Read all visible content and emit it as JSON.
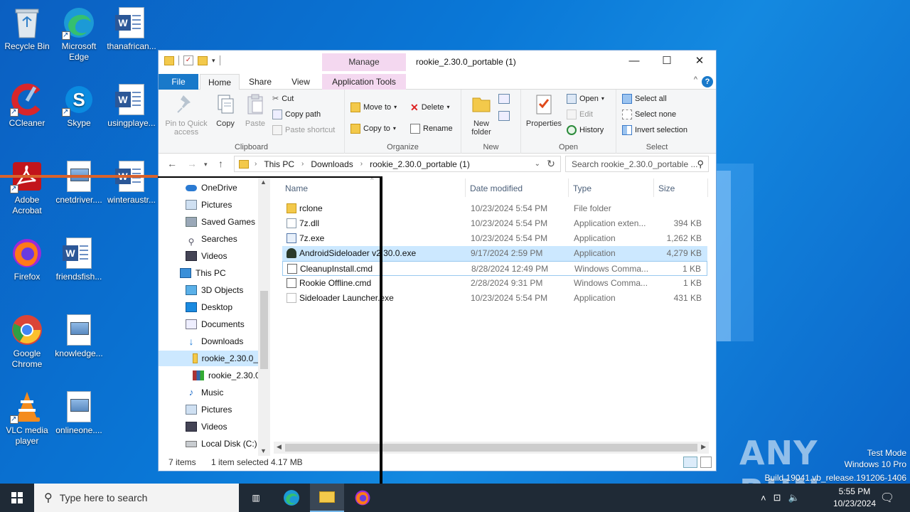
{
  "desktop": {
    "icons": [
      {
        "label": "Recycle Bin"
      },
      {
        "label": "Microsoft Edge"
      },
      {
        "label": "thanafrican..."
      },
      {
        "label": "CCleaner"
      },
      {
        "label": "Skype"
      },
      {
        "label": "usingplaye..."
      },
      {
        "label": "Adobe Acrobat"
      },
      {
        "label": "cnetdriver...."
      },
      {
        "label": "winteraustr..."
      },
      {
        "label": "Firefox"
      },
      {
        "label": "friendsfish..."
      },
      {
        "label": "Google Chrome"
      },
      {
        "label": "knowledge..."
      },
      {
        "label": "VLC media player"
      },
      {
        "label": "onlineone...."
      }
    ]
  },
  "window": {
    "title": "rookie_2.30.0_portable (1)",
    "manage_label": "Manage",
    "tabs": {
      "file": "File",
      "home": "Home",
      "share": "Share",
      "view": "View",
      "app_tools": "Application Tools"
    },
    "controls": {
      "minimize": "—",
      "maximize": "☐",
      "close": "✕",
      "help": "?",
      "collapse": "^"
    }
  },
  "ribbon": {
    "clipboard": {
      "pin": "Pin to Quick access",
      "copy": "Copy",
      "paste": "Paste",
      "cut": "Cut",
      "copy_path": "Copy path",
      "paste_shortcut": "Paste shortcut",
      "label": "Clipboard"
    },
    "organize": {
      "move_to": "Move to",
      "copy_to": "Copy to",
      "delete": "Delete",
      "rename": "Rename",
      "label": "Organize"
    },
    "new": {
      "new_folder": "New folder",
      "label": "New"
    },
    "open": {
      "properties": "Properties",
      "open": "Open",
      "edit": "Edit",
      "history": "History",
      "label": "Open"
    },
    "select": {
      "select_all": "Select all",
      "select_none": "Select none",
      "invert": "Invert selection",
      "label": "Select"
    }
  },
  "address": {
    "crumbs": [
      "This PC",
      "Downloads",
      "rookie_2.30.0_portable (1)"
    ],
    "search_placeholder": "Search rookie_2.30.0_portable ..."
  },
  "navpane": {
    "items": [
      {
        "label": "OneDrive"
      },
      {
        "label": "Pictures"
      },
      {
        "label": "Saved Games"
      },
      {
        "label": "Searches"
      },
      {
        "label": "Videos"
      },
      {
        "label": "This PC"
      },
      {
        "label": "3D Objects"
      },
      {
        "label": "Desktop"
      },
      {
        "label": "Documents"
      },
      {
        "label": "Downloads"
      },
      {
        "label": "rookie_2.30.0_"
      },
      {
        "label": "rookie_2.30.0_"
      },
      {
        "label": "Music"
      },
      {
        "label": "Pictures"
      },
      {
        "label": "Videos"
      },
      {
        "label": "Local Disk (C:)"
      }
    ]
  },
  "files": {
    "headers": {
      "name": "Name",
      "date": "Date modified",
      "type": "Type",
      "size": "Size"
    },
    "rows": [
      {
        "name": "rclone",
        "date": "10/23/2024 5:54 PM",
        "type": "File folder",
        "size": ""
      },
      {
        "name": "7z.dll",
        "date": "10/23/2024 5:54 PM",
        "type": "Application exten...",
        "size": "394 KB"
      },
      {
        "name": "7z.exe",
        "date": "10/23/2024 5:54 PM",
        "type": "Application",
        "size": "1,262 KB"
      },
      {
        "name": "AndroidSideloader v2.30.0.exe",
        "date": "9/17/2024 2:59 PM",
        "type": "Application",
        "size": "4,279 KB"
      },
      {
        "name": "CleanupInstall.cmd",
        "date": "8/28/2024 12:49 PM",
        "type": "Windows Comma...",
        "size": "1 KB"
      },
      {
        "name": "Rookie Offline.cmd",
        "date": "2/28/2024 9:31 PM",
        "type": "Windows Comma...",
        "size": "1 KB"
      },
      {
        "name": "Sideloader Launcher.exe",
        "date": "10/23/2024 5:54 PM",
        "type": "Application",
        "size": "431 KB"
      }
    ]
  },
  "status": {
    "count": "7 items",
    "selected": "1 item selected",
    "size": "4.17 MB"
  },
  "taskbar": {
    "search_placeholder": "Type here to search",
    "time": "5:55 PM",
    "date": "10/23/2024"
  },
  "watermark": {
    "test_mode": "Test Mode",
    "os": "Windows 10 Pro",
    "build": "Build 19041.vb_release.191206-1406",
    "brand": "ANY RUN"
  }
}
